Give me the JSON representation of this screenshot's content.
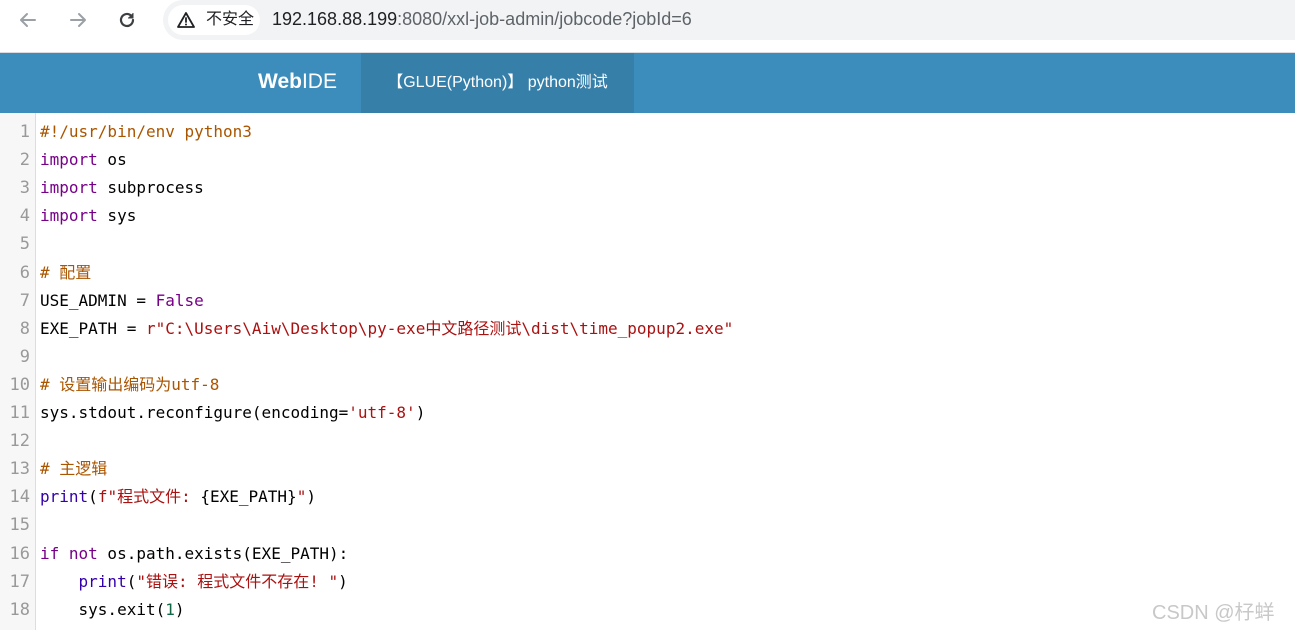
{
  "browser": {
    "security_label": "不安全",
    "url_host": "192.168.88.199",
    "url_path": ":8080/xxl-job-admin/jobcode?jobId=6",
    "icons": {
      "back": "back-arrow-icon",
      "forward": "forward-arrow-icon",
      "reload": "reload-icon",
      "security": "warning-icon"
    }
  },
  "header": {
    "logo_bold": "Web",
    "logo_light": "IDE",
    "job_tab": "【GLUE(Python)】 python测试"
  },
  "editor": {
    "lines": [
      {
        "num": "1",
        "tokens": [
          {
            "t": "comment",
            "v": "#!/usr/bin/env python3"
          }
        ]
      },
      {
        "num": "2",
        "tokens": [
          {
            "t": "keyword",
            "v": "import"
          },
          {
            "t": "plain",
            "v": " os"
          }
        ]
      },
      {
        "num": "3",
        "tokens": [
          {
            "t": "keyword",
            "v": "import"
          },
          {
            "t": "plain",
            "v": " subprocess"
          }
        ]
      },
      {
        "num": "4",
        "tokens": [
          {
            "t": "keyword",
            "v": "import"
          },
          {
            "t": "plain",
            "v": " sys"
          }
        ]
      },
      {
        "num": "5",
        "tokens": []
      },
      {
        "num": "6",
        "tokens": [
          {
            "t": "comment",
            "v": "# 配置"
          }
        ]
      },
      {
        "num": "7",
        "tokens": [
          {
            "t": "plain",
            "v": "USE_ADMIN = "
          },
          {
            "t": "keyword",
            "v": "False"
          }
        ]
      },
      {
        "num": "8",
        "tokens": [
          {
            "t": "plain",
            "v": "EXE_PATH = "
          },
          {
            "t": "string",
            "v": "r\"C:\\Users\\Aiw\\Desktop\\py-exe中文路径测试\\dist\\time_popup2.exe\""
          }
        ]
      },
      {
        "num": "9",
        "tokens": []
      },
      {
        "num": "10",
        "tokens": [
          {
            "t": "comment",
            "v": "# 设置输出编码为utf-8"
          }
        ]
      },
      {
        "num": "11",
        "tokens": [
          {
            "t": "plain",
            "v": "sys.stdout.reconfigure(encoding="
          },
          {
            "t": "string",
            "v": "'utf-8'"
          },
          {
            "t": "plain",
            "v": ")"
          }
        ]
      },
      {
        "num": "12",
        "tokens": []
      },
      {
        "num": "13",
        "tokens": [
          {
            "t": "comment",
            "v": "# 主逻辑"
          }
        ]
      },
      {
        "num": "14",
        "tokens": [
          {
            "t": "builtin",
            "v": "print"
          },
          {
            "t": "plain",
            "v": "("
          },
          {
            "t": "string",
            "v": "f\"程式文件: "
          },
          {
            "t": "plain",
            "v": "{EXE_PATH}"
          },
          {
            "t": "string",
            "v": "\""
          },
          {
            "t": "plain",
            "v": ")"
          }
        ]
      },
      {
        "num": "15",
        "tokens": []
      },
      {
        "num": "16",
        "tokens": [
          {
            "t": "keyword",
            "v": "if not"
          },
          {
            "t": "plain",
            "v": " os.path.exists(EXE_PATH):"
          }
        ]
      },
      {
        "num": "17",
        "tokens": [
          {
            "t": "plain",
            "v": "    "
          },
          {
            "t": "builtin",
            "v": "print"
          },
          {
            "t": "plain",
            "v": "("
          },
          {
            "t": "string",
            "v": "\"错误: 程式文件不存在! \""
          },
          {
            "t": "plain",
            "v": ")"
          }
        ]
      },
      {
        "num": "18",
        "tokens": [
          {
            "t": "plain",
            "v": "    sys.exit("
          },
          {
            "t": "number",
            "v": "1"
          },
          {
            "t": "plain",
            "v": ")"
          }
        ]
      }
    ]
  },
  "watermark": "CSDN @杍蛘",
  "colors": {
    "header_bg": "#3c8dbc",
    "tab_bg": "#367fa9",
    "comment": "#aa5500",
    "keyword": "#770088",
    "builtin": "#3300aa",
    "string": "#aa1111",
    "number": "#116644"
  }
}
